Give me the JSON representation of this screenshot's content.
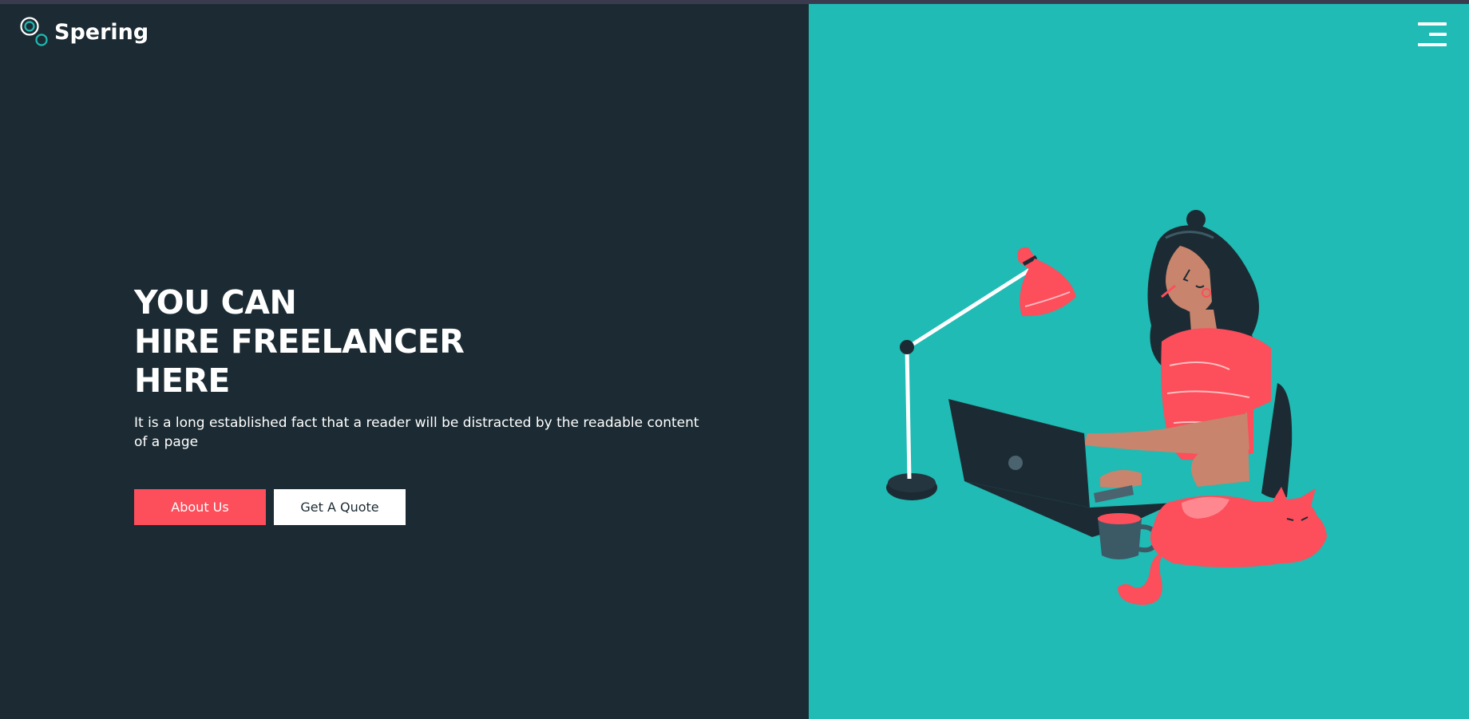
{
  "brand": {
    "name": "Spering",
    "logo_icon": "two-rings-logo-icon"
  },
  "nav": {
    "menu_icon": "hamburger-menu-icon"
  },
  "hero": {
    "title_lines": [
      "YOU CAN",
      "HIRE FREELANCER",
      "HERE"
    ],
    "description": "It is a long established fact that a reader will be distracted by the readable content of a page",
    "buttons": {
      "about": "About Us",
      "quote": "Get A Quote"
    }
  },
  "colors": {
    "left_background": "#1c2b33",
    "right_background": "#1fbbb4",
    "accent": "#fc4e5b",
    "white": "#ffffff"
  }
}
